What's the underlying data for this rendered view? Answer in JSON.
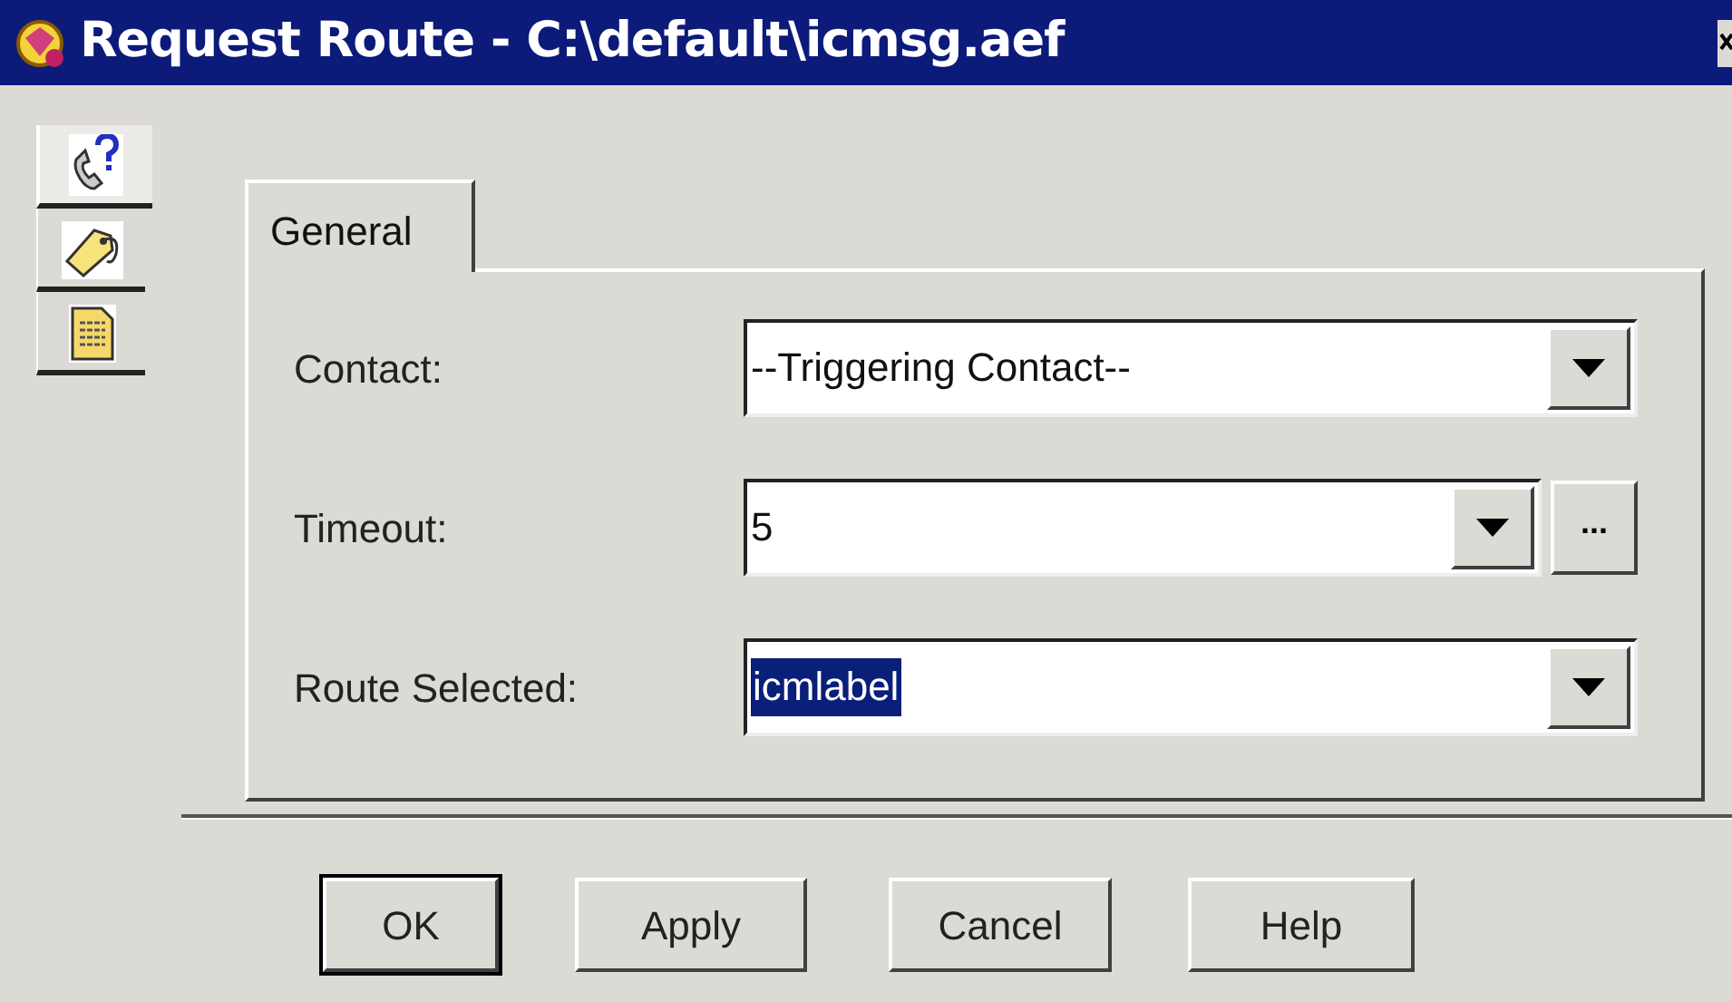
{
  "window": {
    "title": "Request Route - C:\\default\\icmsg.aef"
  },
  "side_tabs": [
    {
      "kind": "phone",
      "selected": true
    },
    {
      "kind": "tag",
      "selected": false
    },
    {
      "kind": "document",
      "selected": false
    }
  ],
  "tabs": [
    {
      "label": "General",
      "selected": true
    }
  ],
  "fields": [
    {
      "label": "Contact:",
      "value": "--Triggering Contact--",
      "kind": "combo",
      "highlighted": false
    },
    {
      "label": "Timeout:",
      "value": "5",
      "kind": "combo_browse",
      "browse_label": "...",
      "highlighted": false
    },
    {
      "label": "Route Selected:",
      "value": "icmlabel",
      "kind": "combo",
      "highlighted": true
    }
  ],
  "buttons": [
    {
      "label": "OK",
      "default": true
    },
    {
      "label": "Apply",
      "default": false
    },
    {
      "label": "Cancel",
      "default": false
    },
    {
      "label": "Help",
      "default": false
    }
  ]
}
